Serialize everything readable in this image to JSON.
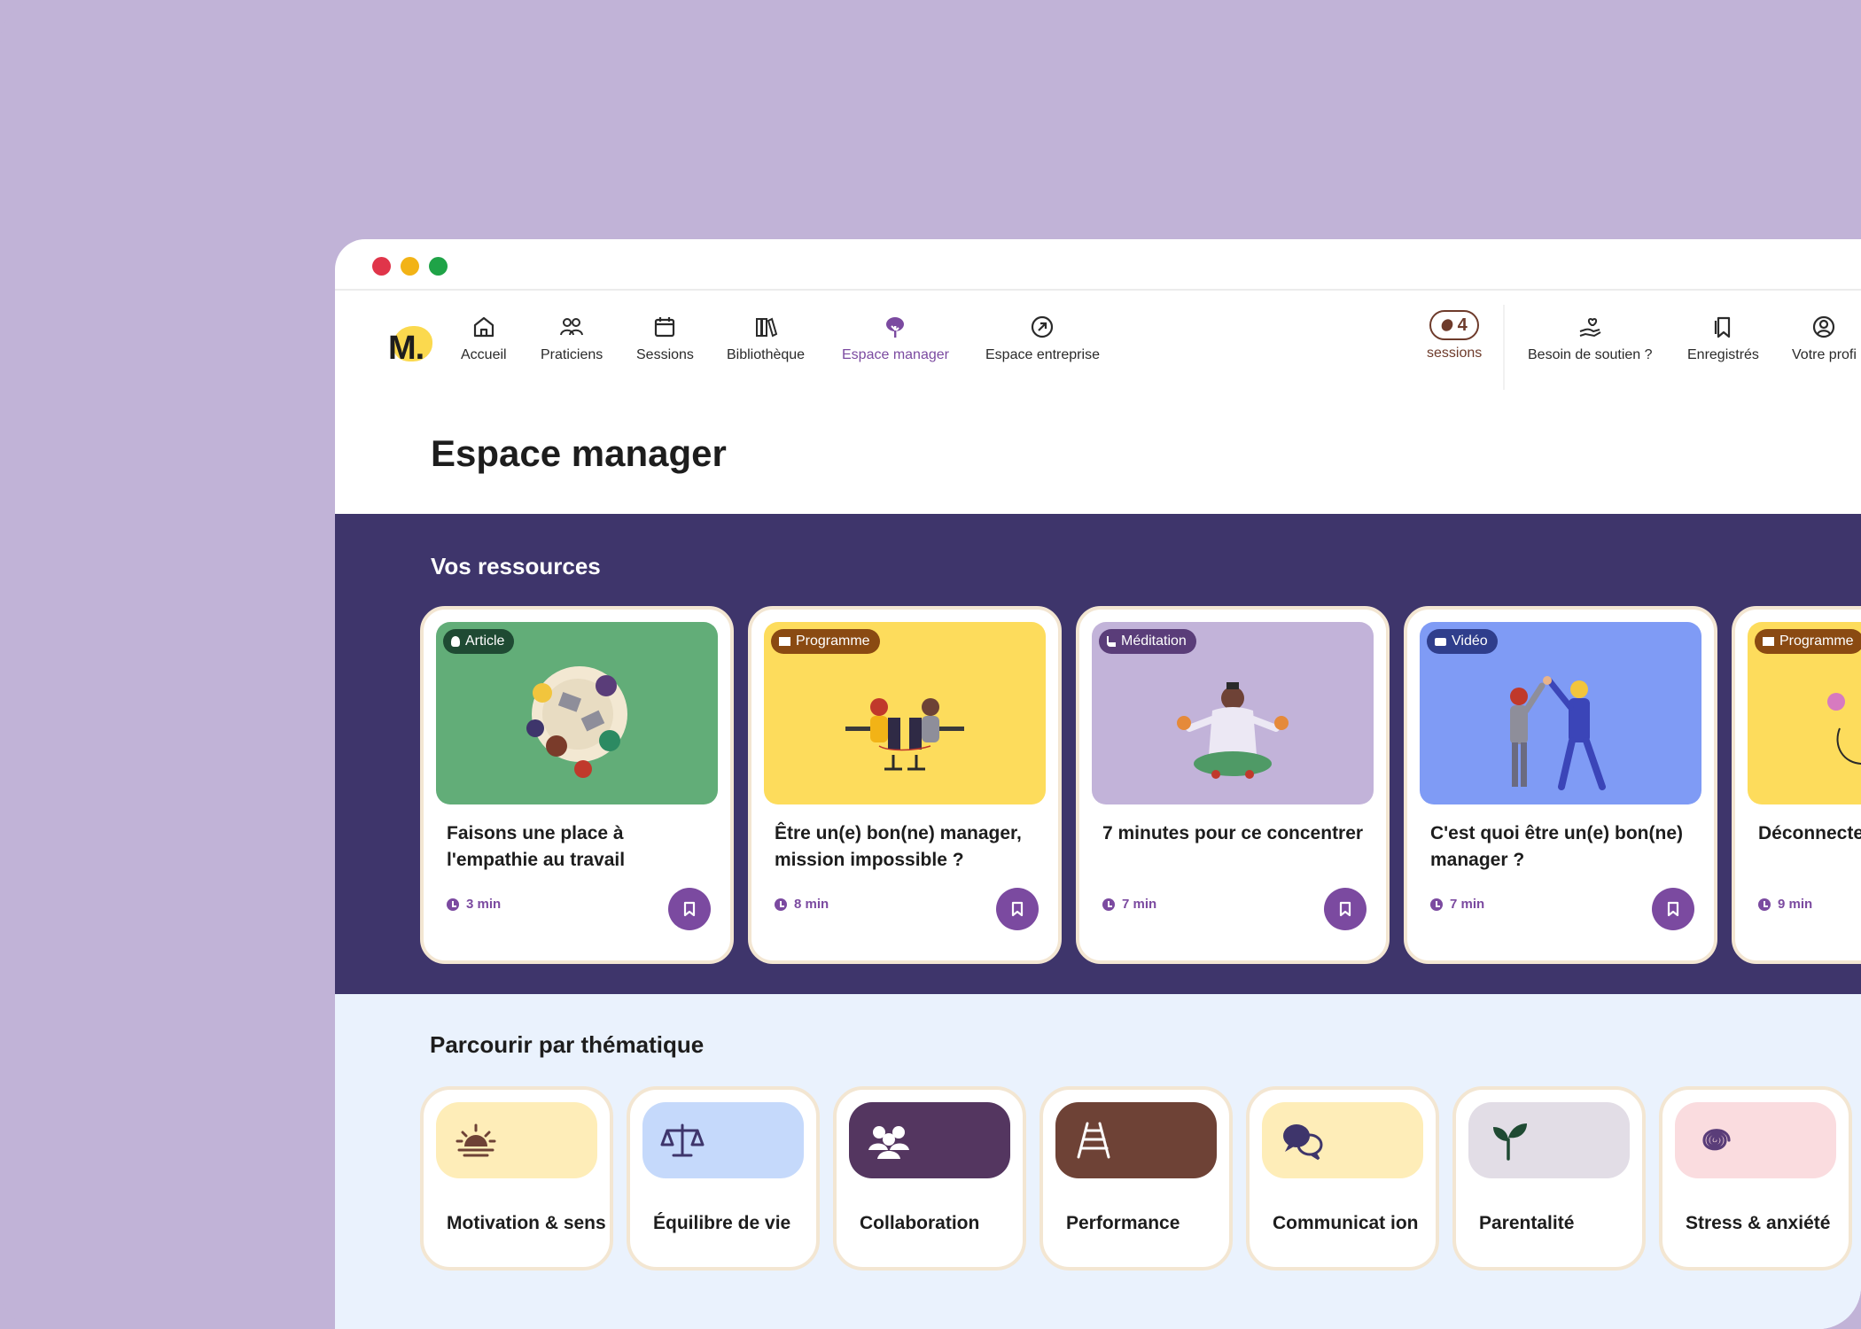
{
  "nav": {
    "items": [
      {
        "label": "Accueil",
        "icon": "home-icon"
      },
      {
        "label": "Praticiens",
        "icon": "people-icon"
      },
      {
        "label": "Sessions",
        "icon": "calendar-icon"
      },
      {
        "label": "Bibliothèque",
        "icon": "books-icon"
      },
      {
        "label": "Espace manager",
        "icon": "tree-icon"
      },
      {
        "label": "Espace entreprise",
        "icon": "arrow-circle-icon"
      }
    ],
    "sessions_count": "4",
    "sessions_label": "sessions",
    "right_items": [
      {
        "label": "Besoin de soutien ?",
        "icon": "hand-heart-icon"
      },
      {
        "label": "Enregistrés",
        "icon": "bookmarks-icon"
      },
      {
        "label": "Votre profi",
        "icon": "user-circle-icon"
      }
    ]
  },
  "page": {
    "title": "Espace manager"
  },
  "resources": {
    "title": "Vos ressources",
    "cards": [
      {
        "type": "Article",
        "title": "Faisons une place à l'empathie au travail",
        "duration": "3 min",
        "bg": "#62ad78",
        "badge_bg": "#1f4a33"
      },
      {
        "type": "Programme",
        "title": "Être un(e) bon(ne) manager, mission impossible ?",
        "duration": "8 min",
        "bg": "#fddc5c",
        "badge_bg": "#8a4a12"
      },
      {
        "type": "Méditation",
        "title": "7 minutes pour ce concentrer",
        "duration": "7 min",
        "bg": "#c2b3d9",
        "badge_bg": "#5a3d79"
      },
      {
        "type": "Vidéo",
        "title": "C'est quoi être un(e) bon(ne) manager ?",
        "duration": "7 min",
        "bg": "#7f9bf5",
        "badge_bg": "#2f3e8c"
      },
      {
        "type": "Programme",
        "title": "Déconnecte",
        "duration": "9 min",
        "bg": "#fddc5c",
        "badge_bg": "#8a4a12"
      }
    ]
  },
  "themes": {
    "title": "Parcourir par thématique",
    "items": [
      {
        "label": "Motivation & sens",
        "bg": "#feedb8",
        "icon": "sunrise-icon"
      },
      {
        "label": "Équilibre de vie",
        "bg": "#c5d9fb",
        "icon": "scale-icon"
      },
      {
        "label": "Collaboration",
        "bg": "#543660",
        "icon": "group-icon"
      },
      {
        "label": "Performance",
        "bg": "#6e4236",
        "icon": "ladder-icon"
      },
      {
        "label": "Communicat ion",
        "bg": "#feedb8",
        "icon": "chat-bubbles-icon"
      },
      {
        "label": "Parentalité",
        "bg": "#e2dde6",
        "icon": "sprout-icon"
      },
      {
        "label": "Stress & anxiété",
        "bg": "#fadcdf",
        "icon": "spiral-icon"
      }
    ]
  }
}
